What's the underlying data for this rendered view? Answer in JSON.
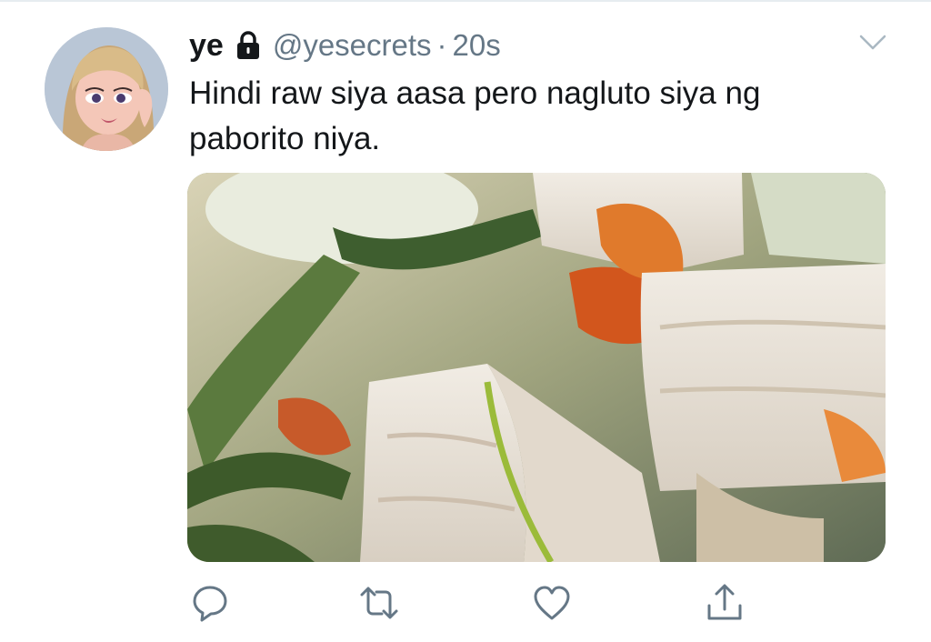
{
  "tweet": {
    "display_name": "ye",
    "handle": "@yesecrets",
    "separator": "·",
    "timestamp": "20s",
    "text_line1": "Hindi raw siya aasa pero nagluto siya ng",
    "text_line2": "paborito niya.",
    "protected_icon": "lock-icon",
    "more_icon": "chevron-down-icon"
  },
  "actions": [
    {
      "icon": "reply-icon"
    },
    {
      "icon": "retweet-icon"
    },
    {
      "icon": "like-icon"
    },
    {
      "icon": "share-icon"
    }
  ],
  "colors": {
    "text": "#14171a",
    "secondary": "#657786",
    "divider": "#e6ecf0"
  }
}
